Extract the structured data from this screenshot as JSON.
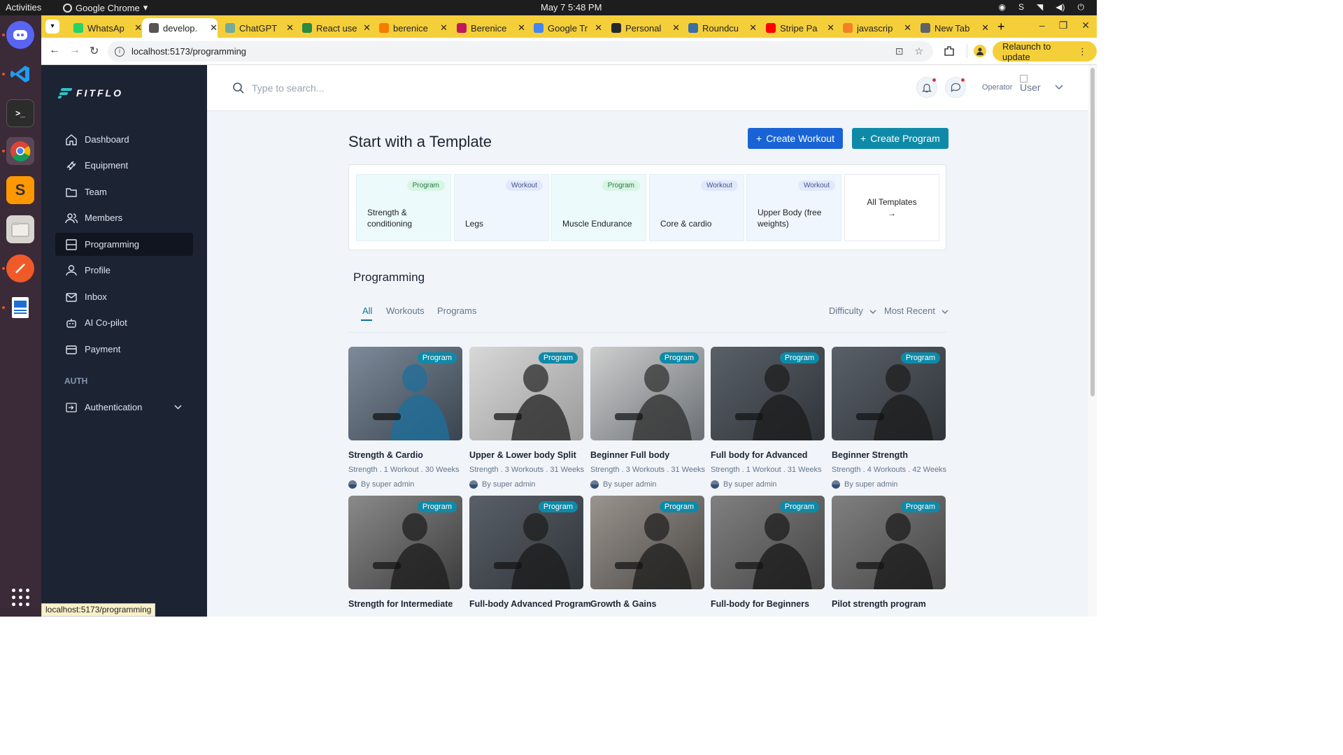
{
  "os": {
    "activities": "Activities",
    "app_name": "Google Chrome",
    "clock": "May 7  5:48 PM"
  },
  "browser": {
    "tabs": [
      {
        "title": "WhatsAp",
        "color": "#25d366"
      },
      {
        "title": "develop.",
        "color": "#555555"
      },
      {
        "title": "ChatGPT",
        "color": "#74aa9c"
      },
      {
        "title": "React use",
        "color": "#2b8a3e"
      },
      {
        "title": "berenice",
        "color": "#f57c00"
      },
      {
        "title": "Berenice",
        "color": "#c2185b"
      },
      {
        "title": "Google Tr",
        "color": "#4285f4"
      },
      {
        "title": "Personal",
        "color": "#24292e"
      },
      {
        "title": "Roundcu",
        "color": "#3a6ea5"
      },
      {
        "title": "Stripe Pa",
        "color": "#ff0000"
      },
      {
        "title": "javascrip",
        "color": "#f48024"
      },
      {
        "title": "New Tab",
        "color": "#5f6368"
      }
    ],
    "url": "localhost:5173/programming",
    "relaunch_label": "Relaunch to update",
    "status_url": "localhost:5173/programming"
  },
  "sidebar": {
    "logo": "FITFLO",
    "items": [
      {
        "label": "Dashboard",
        "icon": "home-icon"
      },
      {
        "label": "Equipment",
        "icon": "dumbbell-icon"
      },
      {
        "label": "Team",
        "icon": "folder-icon"
      },
      {
        "label": "Members",
        "icon": "users-icon"
      },
      {
        "label": "Programming",
        "icon": "layout-icon"
      },
      {
        "label": "Profile",
        "icon": "user-icon"
      },
      {
        "label": "Inbox",
        "icon": "mail-icon"
      },
      {
        "label": "AI Co-pilot",
        "icon": "robot-icon"
      },
      {
        "label": "Payment",
        "icon": "card-icon"
      }
    ],
    "section_auth": "AUTH",
    "auth_item": "Authentication"
  },
  "header": {
    "search_placeholder": "Type to search...",
    "role": "Operator",
    "user_alt": "User"
  },
  "main": {
    "template_title": "Start with a Template",
    "create_workout": "Create Workout",
    "create_program": "Create Program",
    "templates": [
      {
        "badge": "Program",
        "label": "Strength & conditioning"
      },
      {
        "badge": "Workout",
        "label": "Legs"
      },
      {
        "badge": "Program",
        "label": "Muscle Endurance"
      },
      {
        "badge": "Workout",
        "label": "Core & cardio"
      },
      {
        "badge": "Workout",
        "label": "Upper Body (free weights)"
      }
    ],
    "all_templates": "All Templates",
    "all_templates_arrow": "→",
    "section_title": "Programming",
    "filter_tabs": [
      "All",
      "Workouts",
      "Programs"
    ],
    "difficulty": "Difficulty",
    "sort": "Most Recent",
    "programs": [
      {
        "title": "Strength & Cardio",
        "meta": "Strength . 1 Workout . 30 Weeks",
        "author": "By super admin",
        "badge": "Program"
      },
      {
        "title": "Upper & Lower body Split",
        "meta": "Strength . 3 Workouts . 31 Weeks",
        "author": "By super admin",
        "badge": "Program"
      },
      {
        "title": "Beginner Full body",
        "meta": "Strength . 3 Workouts . 31 Weeks",
        "author": "By super admin",
        "badge": "Program"
      },
      {
        "title": "Full body for Advanced",
        "meta": "Strength . 1 Workout . 31 Weeks",
        "author": "By super admin",
        "badge": "Program"
      },
      {
        "title": "Beginner Strength",
        "meta": "Strength . 4 Workouts . 42 Weeks",
        "author": "By super admin",
        "badge": "Program"
      },
      {
        "title": "Strength for Intermediate",
        "meta": "",
        "author": "",
        "badge": "Program"
      },
      {
        "title": "Full-body Advanced Program",
        "meta": "",
        "author": "",
        "badge": "Program"
      },
      {
        "title": "Growth & Gains",
        "meta": "",
        "author": "",
        "badge": "Program"
      },
      {
        "title": "Full-body for Beginners",
        "meta": "",
        "author": "",
        "badge": "Program"
      },
      {
        "title": "Pilot strength program",
        "meta": "",
        "author": "",
        "badge": "Program"
      }
    ]
  }
}
